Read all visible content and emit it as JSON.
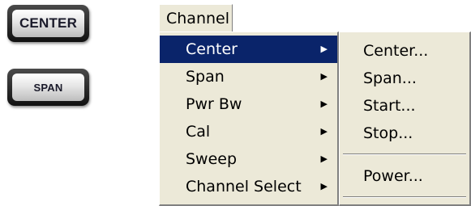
{
  "hardkeys": {
    "center_label": "CENTER",
    "span_label": "SPAN"
  },
  "menubar": {
    "channel_label": "Channel"
  },
  "channel_menu": {
    "items": [
      {
        "label": "Center",
        "arrow": "▶"
      },
      {
        "label": "Span",
        "arrow": "▶"
      },
      {
        "label": "Pwr Bw",
        "arrow": "▶"
      },
      {
        "label": "Cal",
        "arrow": "▶"
      },
      {
        "label": "Sweep",
        "arrow": "▶"
      },
      {
        "label": "Channel Select",
        "arrow": "▶"
      }
    ]
  },
  "center_submenu": {
    "items": [
      {
        "label": "Center..."
      },
      {
        "label": "Span..."
      },
      {
        "label": "Start..."
      },
      {
        "label": "Stop..."
      },
      {
        "label": "Power..."
      }
    ]
  },
  "colors": {
    "menu_background": "#ece9d8",
    "highlight": "#0a246a",
    "highlight_text": "#ffffff"
  }
}
